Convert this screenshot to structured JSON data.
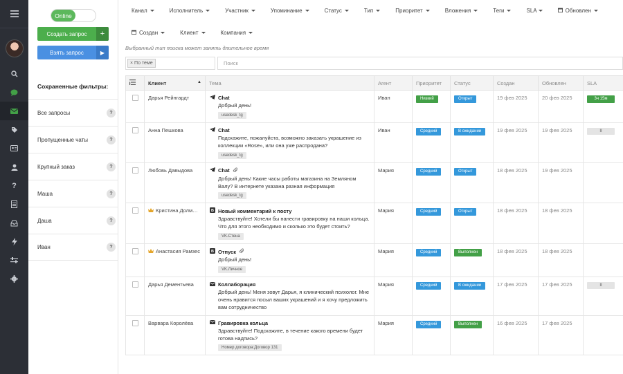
{
  "status": {
    "online_label": "Online"
  },
  "actions": {
    "create_label": "Создать запрос",
    "create_plus": "+",
    "take_label": "Взять запрос",
    "take_play": "▶"
  },
  "saved_filters": {
    "title": "Сохраненные фильтры:",
    "items": [
      {
        "label": "Все запросы",
        "badge": "?"
      },
      {
        "label": "Пропущенные чаты",
        "badge": "?"
      },
      {
        "label": "Крупный заказ",
        "badge": "?"
      },
      {
        "label": "Маша",
        "badge": "?"
      },
      {
        "label": "Даша",
        "badge": "?"
      },
      {
        "label": "Иван",
        "badge": "?"
      }
    ]
  },
  "filters_row1": [
    "Канал",
    "Исполнитель",
    "Участник",
    "Упоминание",
    "Статус",
    "Тип",
    "Приоритет",
    "Вложения",
    "Теги",
    "SLA",
    "Обновлен"
  ],
  "filters_row2": [
    "Создан",
    "Клиент",
    "Компания"
  ],
  "search": {
    "hint": "Выбранный тип поиска может занять длительное время",
    "scope_chip": "× По теме",
    "placeholder": "Поиск"
  },
  "table": {
    "headers": {
      "client": "Клиент",
      "subject": "Тема",
      "agent": "Агент",
      "priority": "Приоритет",
      "status": "Статус",
      "created": "Создан",
      "updated": "Обновлен",
      "sla": "SLA"
    },
    "sort_indicator": "▲",
    "rows": [
      {
        "client": "Дарья Рейнгардт",
        "vip": false,
        "channel_icon": "telegram-icon",
        "subject": "Chat",
        "attachment": false,
        "message": "Добрый день!",
        "tag": "usedesk_tg",
        "agent": "Иван",
        "priority": "Низкий",
        "priority_color": "#43a047",
        "status": "Открыт",
        "status_color": "#3498db",
        "created": "19 фев 2025",
        "updated": "20 фев 2025",
        "sla": "3ч 15м",
        "sla_kind": "timer"
      },
      {
        "client": "Анна Пешкова",
        "vip": false,
        "channel_icon": "telegram-icon",
        "subject": "Chat",
        "attachment": false,
        "message": "Подскажите, пожалуйста, возможно заказать украшение из коллекции «Rose», или она уже распродана?",
        "tag": "usedesk_tg",
        "agent": "Иван",
        "priority": "Средний",
        "priority_color": "#3498db",
        "status": "В ожидании",
        "status_color": "#3498db",
        "created": "19 фев 2025",
        "updated": "19 фев 2025",
        "sla": "II",
        "sla_kind": "paused"
      },
      {
        "client": "Любовь Давыдова",
        "vip": false,
        "channel_icon": "telegram-icon",
        "subject": "Chat",
        "attachment": true,
        "message": "Добрый день! Какие часы работы магазина на Земляном Валу? В интернете указана разная информация",
        "tag": "usedesk_tg",
        "agent": "Мария",
        "priority": "Средний",
        "priority_color": "#3498db",
        "status": "Открыт",
        "status_color": "#3498db",
        "created": "18 фев 2025",
        "updated": "19 фев 2025",
        "sla": "",
        "sla_kind": "none"
      },
      {
        "client": "Кристина Долм…",
        "vip": true,
        "channel_icon": "vk-icon",
        "subject": "Новый комментарий к посту",
        "attachment": false,
        "message": "Здравствуйте! Хотели бы нанести гравировку на наши кольца. Что для этого необходимо и сколько это будет стоить?",
        "tag": "VK.Стена",
        "agent": "Мария",
        "priority": "Средний",
        "priority_color": "#3498db",
        "status": "Открыт",
        "status_color": "#3498db",
        "created": "18 фев 2025",
        "updated": "18 фев 2025",
        "sla": "",
        "sla_kind": "none"
      },
      {
        "client": "Анастасия Рамзес",
        "vip": true,
        "channel_icon": "vk-icon",
        "subject": "Отпуск",
        "attachment": true,
        "message": "Добрый день!",
        "tag": "VK.Личное",
        "agent": "Мария",
        "priority": "Средний",
        "priority_color": "#3498db",
        "status": "Выполнен",
        "status_color": "#43a047",
        "created": "18 фев 2025",
        "updated": "18 фев 2025",
        "sla": "",
        "sla_kind": "none"
      },
      {
        "client": "Дарья Дементьева",
        "vip": false,
        "channel_icon": "mail-icon",
        "subject": "Коллаборация",
        "attachment": false,
        "message": "Добрый день! Меня зовут Дарья, я клинический психолог. Мне очень нравится посыл ваших украшений и я хочу предложить вам сотрудничество",
        "tag": "",
        "agent": "Мария",
        "priority": "Средний",
        "priority_color": "#3498db",
        "status": "В ожидании",
        "status_color": "#3498db",
        "created": "17 фев 2025",
        "updated": "17 фев 2025",
        "sla": "II",
        "sla_kind": "paused"
      },
      {
        "client": "Варвара Королёва",
        "vip": false,
        "channel_icon": "mail-icon",
        "subject": "Гравировка кольца",
        "attachment": false,
        "message": "Здравствуйте! Подскажите, в течение какого времени будет готова надпись?",
        "tag": "Номер договора:Договор 131",
        "agent": "Мария",
        "priority": "Средний",
        "priority_color": "#3498db",
        "status": "Выполнен",
        "status_color": "#43a047",
        "created": "16 фев 2025",
        "updated": "17 фев 2025",
        "sla": "",
        "sla_kind": "none"
      }
    ]
  }
}
